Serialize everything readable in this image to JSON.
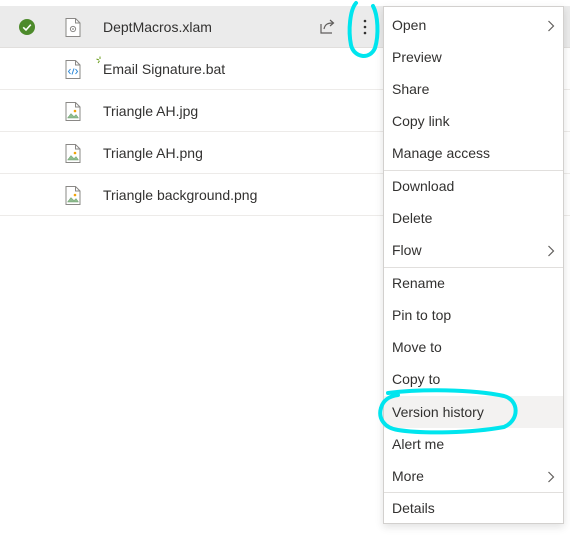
{
  "files": [
    {
      "name": "DeptMacros.xlam",
      "icon": "gear-file-icon",
      "selected": true
    },
    {
      "name": "Email Signature.bat",
      "icon": "code-file-icon",
      "new": true
    },
    {
      "name": "Triangle AH.jpg",
      "icon": "image-file-icon"
    },
    {
      "name": "Triangle AH.png",
      "icon": "image-file-icon"
    },
    {
      "name": "Triangle background.png",
      "icon": "image-file-icon"
    }
  ],
  "context_menu": {
    "items": [
      {
        "label": "Open",
        "submenu": true
      },
      {
        "label": "Preview"
      },
      {
        "label": "Share"
      },
      {
        "label": "Copy link"
      },
      {
        "label": "Manage access"
      },
      {
        "label": "Download"
      },
      {
        "label": "Delete"
      },
      {
        "label": "Flow",
        "submenu": true
      },
      {
        "label": "Rename"
      },
      {
        "label": "Pin to top"
      },
      {
        "label": "Move to"
      },
      {
        "label": "Copy to"
      },
      {
        "label": "Version history",
        "highlighted": true
      },
      {
        "label": "Alert me"
      },
      {
        "label": "More",
        "submenu": true
      },
      {
        "label": "Details"
      }
    ]
  },
  "colors": {
    "accent": "#00e5ee",
    "check": "#4d8a2b",
    "selected_row": "#ebebeb"
  }
}
